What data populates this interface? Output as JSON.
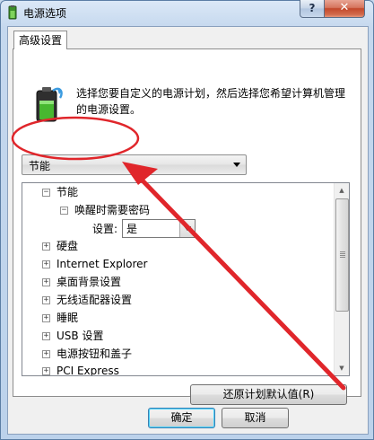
{
  "window": {
    "title": "电源选项",
    "help_label": "?",
    "close_label": "✕"
  },
  "tabs": [
    {
      "label": "高级设置"
    }
  ],
  "description": "选择您要自定义的电源计划，然后选择您希望计算机管理的电源设置。",
  "plan_dropdown": {
    "selected": "节能"
  },
  "tree": {
    "root": {
      "label": "节能",
      "expanded": true,
      "toggle": "−"
    },
    "child": {
      "label": "唤醒时需要密码",
      "expanded": true,
      "toggle": "−"
    },
    "setting": {
      "label": "设置:",
      "value": "是"
    },
    "items": [
      {
        "label": "硬盘",
        "toggle": "+"
      },
      {
        "label": "Internet Explorer",
        "toggle": "+"
      },
      {
        "label": "桌面背景设置",
        "toggle": "+"
      },
      {
        "label": "无线适配器设置",
        "toggle": "+"
      },
      {
        "label": "睡眠",
        "toggle": "+"
      },
      {
        "label": "USB 设置",
        "toggle": "+"
      },
      {
        "label": "电源按钮和盖子",
        "toggle": "+"
      },
      {
        "label": "PCI Express",
        "toggle": "+"
      }
    ]
  },
  "scrollbar": {
    "up_arrow": "▲",
    "down_arrow": "▼"
  },
  "buttons": {
    "restore": "还原计划默认值(R)",
    "ok": "确定",
    "cancel": "取消"
  },
  "annotation_color": "#e0262b"
}
